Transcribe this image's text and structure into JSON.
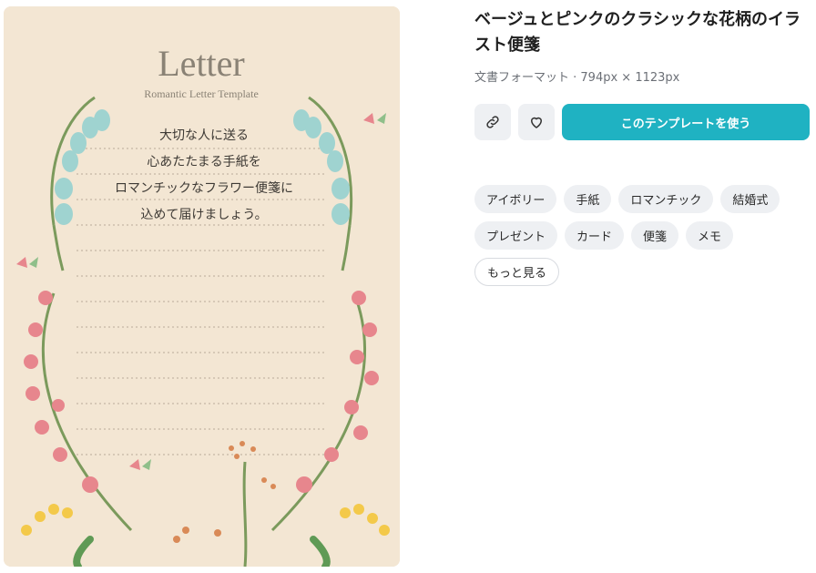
{
  "preview": {
    "heading": "Letter",
    "subheading": "Romantic Letter Template",
    "lines": [
      "大切な人に送る",
      "心あたたまる手紙を",
      "ロマンチックなフラワー便箋に",
      "込めて届けましょう。"
    ]
  },
  "template": {
    "title": "ベージュとピンクのクラシックな花柄のイラスト便箋",
    "meta": "文書フォーマット · 794px × 1123px"
  },
  "actions": {
    "link_icon": "link-icon",
    "favorite_icon": "heart-icon",
    "use_label": "このテンプレートを使う"
  },
  "tags": [
    "アイボリー",
    "手紙",
    "ロマンチック",
    "結婚式",
    "プレゼント",
    "カード",
    "便箋",
    "メモ"
  ],
  "more_label": "もっと見る",
  "colors": {
    "accent": "#1fb2c2",
    "paper": "#f3e6d3",
    "pink_flower": "#e7868d",
    "blue_flower": "#9fd3d0",
    "stem": "#7b9a5c",
    "yellow_flower": "#f3c94a"
  }
}
